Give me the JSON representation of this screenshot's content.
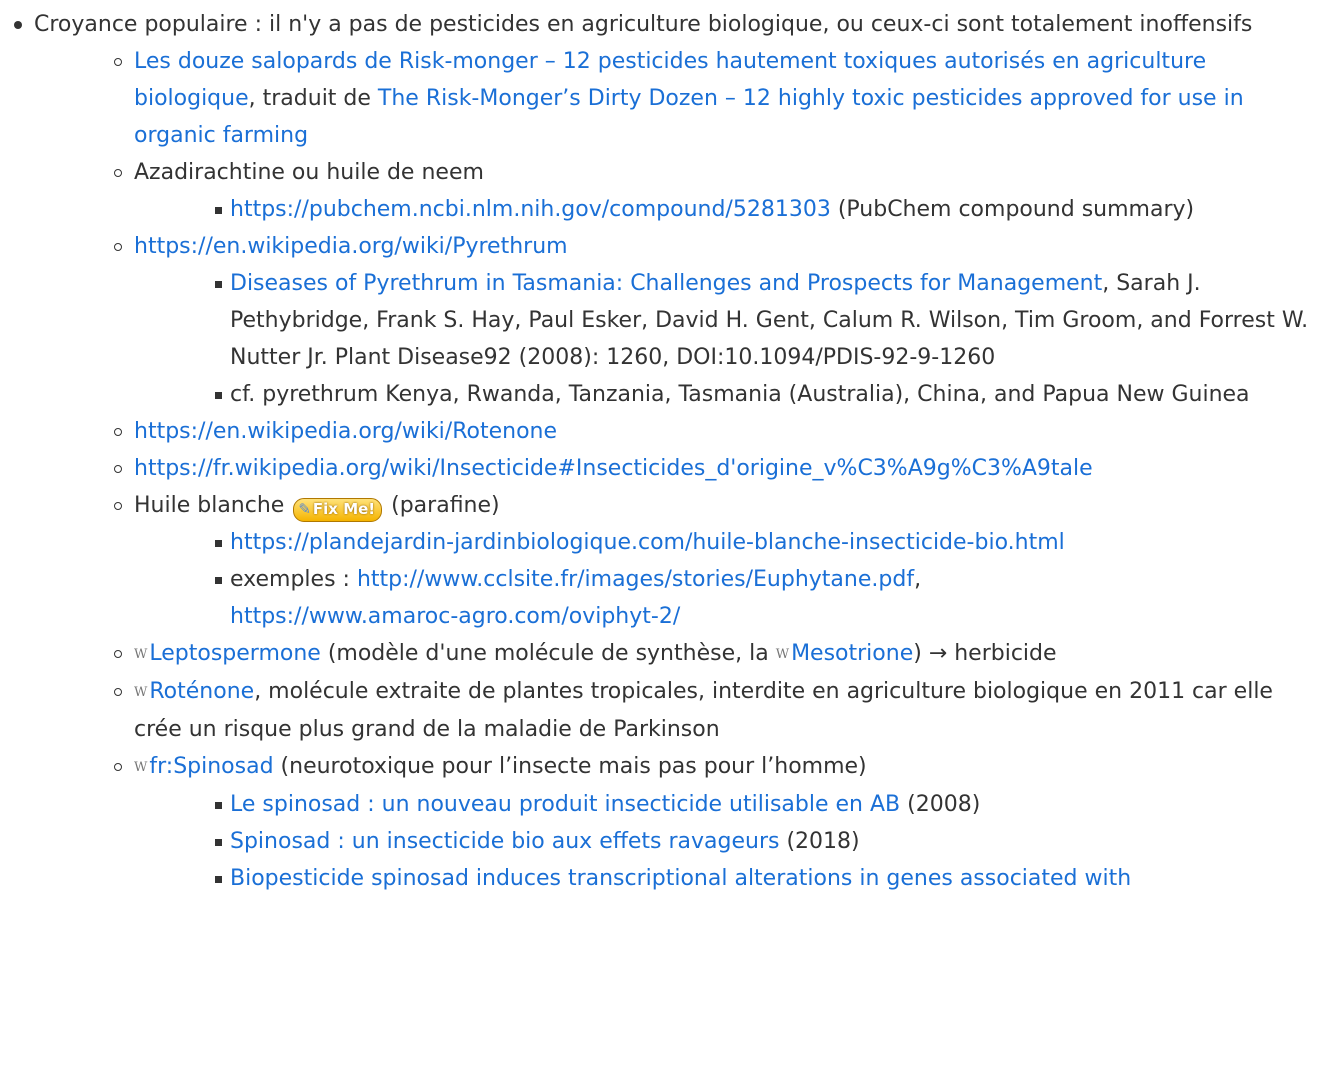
{
  "root_item": {
    "text": "Croyance populaire : il n'y a pas de pesticides en agriculture biologique, ou ceux-ci sont totalement inoffensifs"
  },
  "items": {
    "dirty_dozen": {
      "link_fr": "Les douze salopards de Risk-monger – 12 pesticides hautement toxiques autorisés en agriculture biologique",
      "mid_text": ", traduit de ",
      "link_en": "The Risk-Monger’s Dirty Dozen – 12 highly toxic pesticides approved for use in organic farming"
    },
    "azadirachtine": {
      "label": "Azadirachtine ou huile de neem",
      "pubchem_link": "https://pubchem.ncbi.nlm.nih.gov/compound/5281303",
      "pubchem_note": " (PubChem compound summary)"
    },
    "pyrethrum": {
      "link": "https://en.wikipedia.org/wiki/Pyrethrum",
      "diseases_link": "Diseases of Pyrethrum in Tasmania: Challenges and Prospects for Management",
      "diseases_text": ", Sarah J. Pethybridge, Frank S. Hay, Paul Esker, David H. Gent, Calum R. Wilson, Tim Groom, and Forrest W. Nutter Jr. Plant Disease92 (2008): 1260, DOI:10.1094/PDIS-92-9-1260",
      "countries_text": "cf. pyrethrum Kenya, Rwanda, Tanzania, Tasmania (Australia), China, and Papua New Guinea"
    },
    "rotenone_en": {
      "link": "https://en.wikipedia.org/wiki/Rotenone"
    },
    "insecticide_fr": {
      "link": "https://fr.wikipedia.org/wiki/Insecticide#Insecticides_d'origine_v%C3%A9g%C3%A9tale"
    },
    "huile_blanche": {
      "label": "Huile blanche",
      "fixme_label": "Fix Me!",
      "suffix": " (parafine)",
      "link1": "https://plandejardin-jardinbiologique.com/huile-blanche-insecticide-bio.html",
      "examples_prefix": "exemples : ",
      "link2": "http://www.cclsite.fr/images/stories/Euphytane.pdf",
      "sep": ", ",
      "link3": "https://www.amaroc-agro.com/oviphyt-2/"
    },
    "leptospermone": {
      "link": "Leptospermone",
      "mid_text": " (modèle d'une molécule de synthèse, la ",
      "link2": "Mesotrione",
      "end_text": ") → herbicide"
    },
    "rotenone_fr": {
      "link": "Roténone",
      "text": ", molécule extraite de plantes tropicales, interdite en agriculture biologique en 2011 car elle crée un risque plus grand de la maladie de Parkinson"
    },
    "spinosad": {
      "link": "fr:Spinosad",
      "text": " (neurotoxique pour l’insecte mais pas pour l’homme)",
      "sub1_link": "Le spinosad : un nouveau produit insecticide utilisable en AB",
      "sub1_year": " (2008)",
      "sub2_link": "Spinosad : un insecticide bio aux effets ravageurs",
      "sub2_year": " (2018)",
      "sub3_link": "Biopesticide spinosad induces transcriptional alterations in genes associated with"
    }
  },
  "icons": {
    "wiki_glyph": "W"
  },
  "colors": {
    "link": "#1a6fd6",
    "text": "#333333",
    "fixme_bg": "#f5b400"
  }
}
